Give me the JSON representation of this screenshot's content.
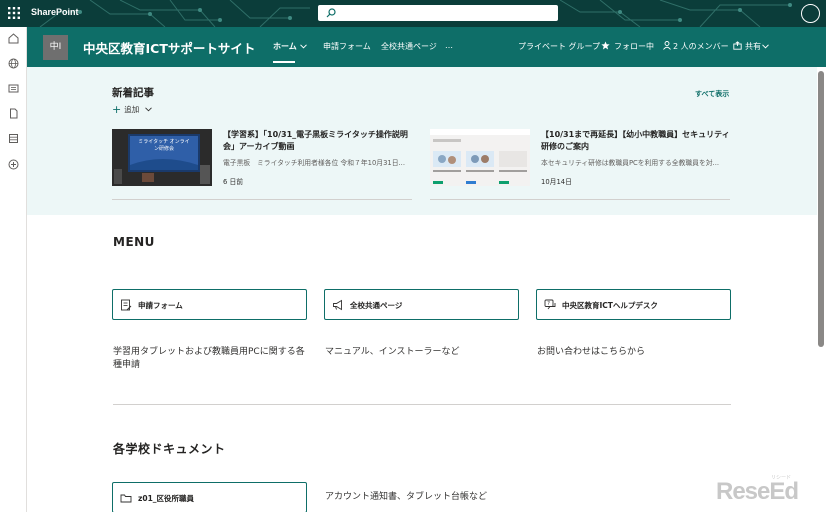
{
  "suite_bar": {
    "app_name": "SharePoint",
    "search_placeholder": ""
  },
  "site_header": {
    "logo_text": "中I",
    "title": "中央区教育ICTサポートサイト",
    "nav": [
      {
        "label": "ホーム",
        "selected": true,
        "chevron": "chevron-down-icon"
      },
      {
        "label": "申請フォーム"
      },
      {
        "label": "全校共通ページ"
      },
      {
        "label": "…"
      }
    ],
    "privacy": "プライベート グループ",
    "follow": "フォロー中",
    "members": "2 人のメンバー",
    "share": "共有"
  },
  "news": {
    "title": "新着記事",
    "add_label": "追加",
    "see_all": "すべて表示",
    "items": [
      {
        "title": "【学習系】「10/31_電子黒板ミライタッチ操作説明会」アーカイブ動画",
        "description": "電子黒板　ミライタッチ利用者様各位 令和７年10月31日...",
        "date": "6 日前",
        "thumb_text": "ミライタッチ オンライン研修会"
      },
      {
        "title": "【10/31まで再延長】【幼小中教職員】セキュリティ研修のご案内",
        "description": "本セキュリティ研修は教職員PCを利用する全教職員を対...",
        "date": "10月14日"
      }
    ]
  },
  "menu": {
    "title": "MENU",
    "items": [
      {
        "label": "申請フォーム",
        "icon": "form-icon",
        "description": "学習用タブレットおよび教職員用PCに関する各種申請"
      },
      {
        "label": "全校共通ページ",
        "icon": "megaphone-icon",
        "description": "マニュアル、インストーラーなど"
      },
      {
        "label": "中央区教育ICTヘルプデスク",
        "icon": "help-chat-icon",
        "description": "お問い合わせはこちらから"
      }
    ]
  },
  "documents": {
    "title": "各学校ドキュメント",
    "items": [
      {
        "label": "z01_区役所職員",
        "icon": "folder-icon",
        "description": "アカウント通知書、タブレット台帳など"
      }
    ]
  },
  "watermark": {
    "text": "ReseEd",
    "sub": "リシード"
  },
  "colors": {
    "header": "#0e6e68",
    "suite_bar": "#0b3d3a",
    "news_bg": "#edf7f7",
    "accent": "#0e6e68"
  }
}
